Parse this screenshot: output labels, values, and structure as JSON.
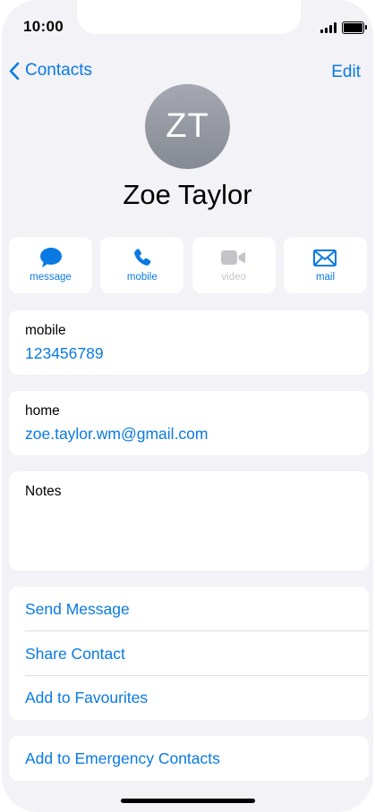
{
  "status_bar": {
    "time": "10:00"
  },
  "nav": {
    "back_label": "Contacts",
    "edit_label": "Edit"
  },
  "contact": {
    "initials": "ZT",
    "name": "Zoe Taylor",
    "phone_label": "mobile",
    "phone_value": "123456789",
    "email_label": "home",
    "email_value": "zoe.taylor.wm@gmail.com",
    "notes_label": "Notes"
  },
  "actions": [
    {
      "label": "message",
      "icon": "message-bubble-icon",
      "enabled": true
    },
    {
      "label": "mobile",
      "icon": "phone-icon",
      "enabled": true
    },
    {
      "label": "video",
      "icon": "video-camera-icon",
      "enabled": false
    },
    {
      "label": "mail",
      "icon": "envelope-icon",
      "enabled": true
    }
  ],
  "options": {
    "send_message": "Send Message",
    "share_contact": "Share Contact",
    "add_to_favourites": "Add to Favourites",
    "add_to_emergency": "Add to Emergency Contacts"
  },
  "colors": {
    "accent": "#0a7ae3",
    "background": "#f2f2f7",
    "card": "#ffffff",
    "disabled": "#c4c4c8"
  }
}
